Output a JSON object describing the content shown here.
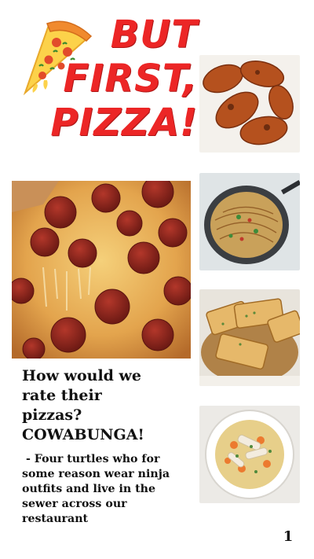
{
  "headline": {
    "line1": "BUT",
    "line2": "FIRST,",
    "line3": "PIZZA!",
    "color": "#ec2626"
  },
  "icons": {
    "decor": "pizza-slice-icon"
  },
  "review": {
    "title_lines": [
      "How would we",
      "rate their",
      "pizzas?",
      "COWABUNGA!"
    ],
    "quote_lines": [
      " - Four turtles who for",
      "some reason wear ninja",
      "outfits and live in the",
      "sewer across our",
      "restaurant"
    ]
  },
  "page_number": "1"
}
